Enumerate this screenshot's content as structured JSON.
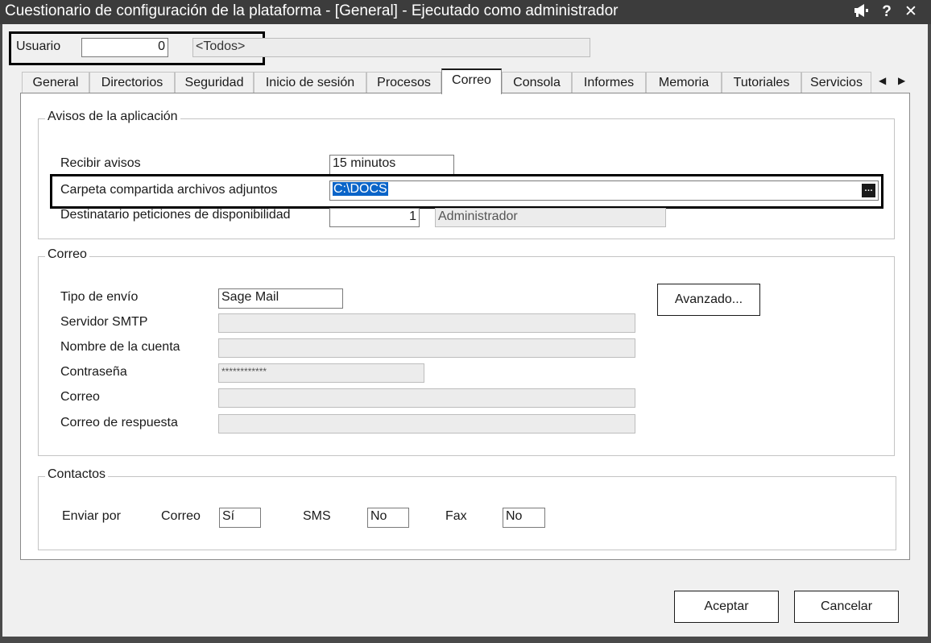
{
  "window": {
    "title": "Cuestionario de configuración de la plataforma - [General] - Ejecutado como administrador",
    "icons": [
      "megaphone-icon",
      "help-icon",
      "close-icon"
    ]
  },
  "header": {
    "user_label": "Usuario",
    "user_value": "0",
    "user_name": "<Todos>"
  },
  "tabs": [
    "General",
    "Directorios",
    "Seguridad",
    "Inicio de sesión",
    "Procesos",
    "Correo",
    "Consola",
    "Informes",
    "Memoria",
    "Tutoriales",
    "Servicios"
  ],
  "active_tab": "Correo",
  "avisos": {
    "title": "Avisos de la aplicación",
    "recibir_label": "Recibir avisos",
    "recibir_value": "15 minutos",
    "carpeta_label": "Carpeta compartida archivos adjuntos",
    "carpeta_value": "C:\\DOCS",
    "destinatario_label": "Destinatario peticiones de disponibilidad",
    "destinatario_value": "1",
    "destinatario_name": "Administrador"
  },
  "correo": {
    "title": "Correo",
    "tipo_label": "Tipo de envío",
    "tipo_value": "Sage Mail",
    "smtp_label": "Servidor SMTP",
    "smtp_value": "",
    "cuenta_label": "Nombre de la cuenta",
    "cuenta_value": "",
    "password_label": "Contraseña",
    "password_value": "************",
    "correo_label": "Correo",
    "correo_value": "",
    "respuesta_label": "Correo de respuesta",
    "respuesta_value": "",
    "avanzado_button": "Avanzado..."
  },
  "contactos": {
    "title": "Contactos",
    "enviar_por": "Enviar por",
    "correo_label": "Correo",
    "correo_value": "Sí",
    "sms_label": "SMS",
    "sms_value": "No",
    "fax_label": "Fax",
    "fax_value": "No"
  },
  "footer": {
    "accept_button": "Aceptar",
    "cancel_button": "Cancelar"
  },
  "colors": {
    "titlebar": "#3c3c3c",
    "selection": "#0a64c8"
  }
}
